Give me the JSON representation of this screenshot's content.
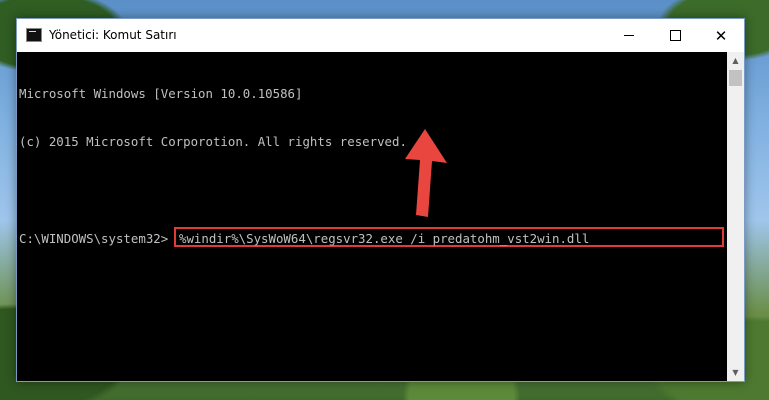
{
  "window": {
    "title": "Yönetici: Komut Satırı",
    "controls": {
      "minimize": "minimize",
      "maximize": "maximize",
      "close": "✕"
    }
  },
  "console": {
    "lines": [
      "Microsoft Windows [Version 10.0.10586]",
      "(c) 2015 Microsoft Corporotion. All rights reserved."
    ],
    "prompt": "C:\\WINDOWS\\system32>",
    "command": "%windir%\\SysWoW64\\regsvr32.exe /i predatohm_vst2win.dll"
  },
  "colors": {
    "highlight": "#e03b36",
    "arrow": "#e8463f",
    "console_text": "#c0c0c0",
    "console_bg": "#000000"
  },
  "icons": {
    "title": "cmd-icon",
    "arrow": "arrow-up-pointer"
  }
}
